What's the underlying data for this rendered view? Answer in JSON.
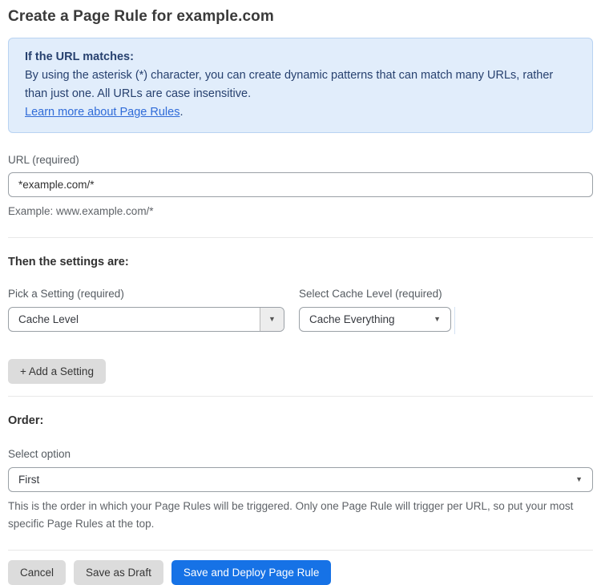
{
  "page": {
    "title": "Create a Page Rule for example.com"
  },
  "info_box": {
    "heading": "If the URL matches:",
    "body": "By using the asterisk (*) character, you can create dynamic patterns that can match many URLs, rather than just one. All URLs are case insensitive.",
    "link": "Learn more about Page Rules",
    "link_suffix": "."
  },
  "url_field": {
    "label": "URL (required)",
    "value": "*example.com/*",
    "hint": "Example: www.example.com/*"
  },
  "settings_section": {
    "heading": "Then the settings are:",
    "setting_label": "Pick a Setting (required)",
    "setting_value": "Cache Level",
    "cache_label": "Select Cache Level (required)",
    "cache_value": "Cache Everything",
    "add_button_label": "+ Add a Setting"
  },
  "order_section": {
    "heading": "Order:",
    "label": "Select option",
    "value": "First",
    "hint": "This is the order in which your Page Rules will be triggered. Only one Page Rule will trigger per URL, so put your most specific Page Rules at the top."
  },
  "footer": {
    "cancel_label": "Cancel",
    "save_draft_label": "Save as Draft",
    "save_deploy_label": "Save and Deploy Page Rule"
  },
  "icons": {
    "dropdown": "caret-down-icon"
  },
  "colors": {
    "accent_blue": "#1672e6",
    "info_bg": "#e1edfb",
    "info_border": "#b9d3f2",
    "info_text": "#27416f",
    "link_blue": "#2f6bd8",
    "button_gray": "#dcdcdc"
  }
}
